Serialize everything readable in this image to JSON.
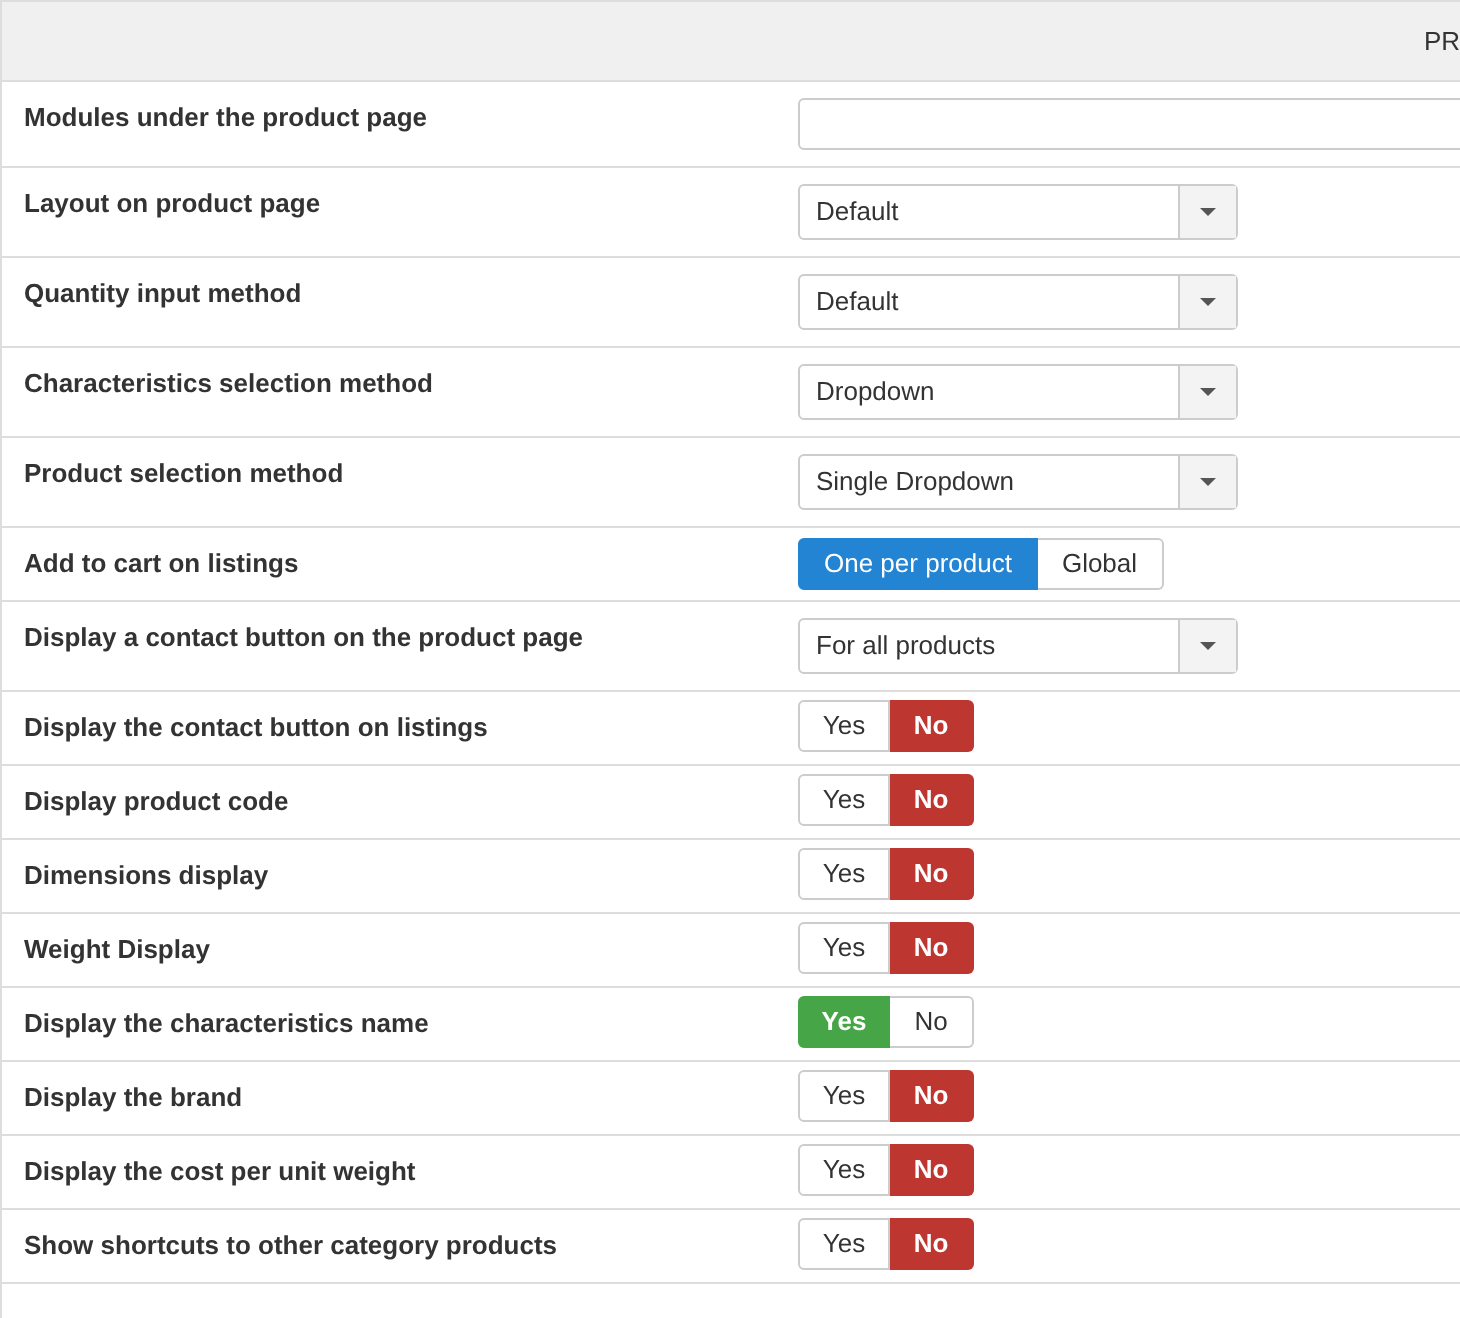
{
  "header": {
    "title": "PR"
  },
  "rows": [
    {
      "label": "Modules under the product page",
      "kind": "text",
      "value": ""
    },
    {
      "label": "Layout on product page",
      "kind": "select",
      "value": "Default"
    },
    {
      "label": "Quantity input method",
      "kind": "select",
      "value": "Default"
    },
    {
      "label": "Characteristics selection method",
      "kind": "select",
      "value": "Dropdown"
    },
    {
      "label": "Product selection method",
      "kind": "select",
      "value": "Single Dropdown"
    },
    {
      "label": "Add to cart on listings",
      "kind": "choice",
      "options": [
        {
          "label": "One per product",
          "selected": true
        },
        {
          "label": "Global",
          "selected": false
        }
      ]
    },
    {
      "label": "Display a contact button on the product page",
      "kind": "select",
      "value": "For all products"
    },
    {
      "label": "Display the contact button on listings",
      "kind": "yesno",
      "options": [
        {
          "label": "Yes",
          "selected": false
        },
        {
          "label": "No",
          "selected": true
        }
      ]
    },
    {
      "label": "Display product code",
      "kind": "yesno",
      "options": [
        {
          "label": "Yes",
          "selected": false
        },
        {
          "label": "No",
          "selected": true
        }
      ]
    },
    {
      "label": "Dimensions display",
      "kind": "yesno",
      "options": [
        {
          "label": "Yes",
          "selected": false
        },
        {
          "label": "No",
          "selected": true
        }
      ]
    },
    {
      "label": "Weight Display",
      "kind": "yesno",
      "options": [
        {
          "label": "Yes",
          "selected": false
        },
        {
          "label": "No",
          "selected": true
        }
      ]
    },
    {
      "label": "Display the characteristics name",
      "kind": "yesno",
      "options": [
        {
          "label": "Yes",
          "selected": true
        },
        {
          "label": "No",
          "selected": false
        }
      ]
    },
    {
      "label": "Display the brand",
      "kind": "yesno",
      "options": [
        {
          "label": "Yes",
          "selected": false
        },
        {
          "label": "No",
          "selected": true
        }
      ]
    },
    {
      "label": "Display the cost per unit weight",
      "kind": "yesno",
      "options": [
        {
          "label": "Yes",
          "selected": false
        },
        {
          "label": "No",
          "selected": true
        }
      ]
    },
    {
      "label": "Show shortcuts to other category products",
      "kind": "yesno",
      "options": [
        {
          "label": "Yes",
          "selected": false
        },
        {
          "label": "No",
          "selected": true
        }
      ]
    }
  ]
}
